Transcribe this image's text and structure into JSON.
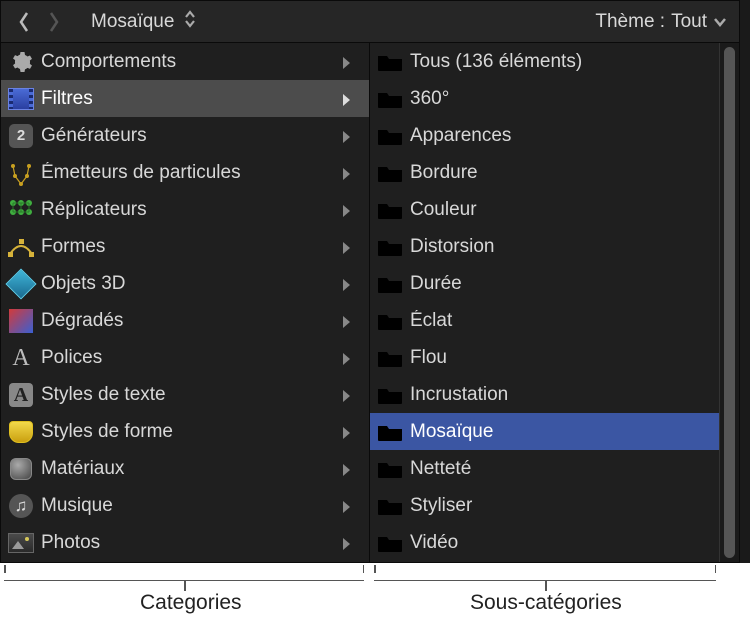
{
  "toolbar": {
    "path_label": "Mosaïque",
    "theme_prefix": "Thème : ",
    "theme_value": "Tout"
  },
  "categories": [
    {
      "icon": "gear",
      "label": "Comportements",
      "selected": false
    },
    {
      "icon": "film",
      "label": "Filtres",
      "selected": true
    },
    {
      "icon": "gen",
      "label": "Générateurs",
      "selected": false
    },
    {
      "icon": "emit",
      "label": "Émetteurs de particules",
      "selected": false
    },
    {
      "icon": "repl",
      "label": "Réplicateurs",
      "selected": false
    },
    {
      "icon": "shape",
      "label": "Formes",
      "selected": false
    },
    {
      "icon": "3d",
      "label": "Objets 3D",
      "selected": false
    },
    {
      "icon": "grad",
      "label": "Dégradés",
      "selected": false
    },
    {
      "icon": "font",
      "label": "Polices",
      "selected": false
    },
    {
      "icon": "tstyle",
      "label": "Styles de texte",
      "selected": false
    },
    {
      "icon": "sstyle",
      "label": "Styles de forme",
      "selected": false
    },
    {
      "icon": "mat",
      "label": "Matériaux",
      "selected": false
    },
    {
      "icon": "music",
      "label": "Musique",
      "selected": false
    },
    {
      "icon": "photo",
      "label": "Photos",
      "selected": false
    }
  ],
  "subcategories": [
    {
      "label": "Tous (136 éléments)",
      "selected": false
    },
    {
      "label": "360°",
      "selected": false
    },
    {
      "label": "Apparences",
      "selected": false
    },
    {
      "label": "Bordure",
      "selected": false
    },
    {
      "label": "Couleur",
      "selected": false
    },
    {
      "label": "Distorsion",
      "selected": false
    },
    {
      "label": "Durée",
      "selected": false
    },
    {
      "label": "Éclat",
      "selected": false
    },
    {
      "label": "Flou",
      "selected": false
    },
    {
      "label": "Incrustation",
      "selected": false
    },
    {
      "label": "Mosaïque",
      "selected": true
    },
    {
      "label": "Netteté",
      "selected": false
    },
    {
      "label": "Styliser",
      "selected": false
    },
    {
      "label": "Vidéo",
      "selected": false
    }
  ],
  "annotations": {
    "left": "Categories",
    "right": "Sous-catégories"
  },
  "gen_badge": "2",
  "font_glyph": "A",
  "tstyle_glyph": "A",
  "music_glyph": "♫"
}
